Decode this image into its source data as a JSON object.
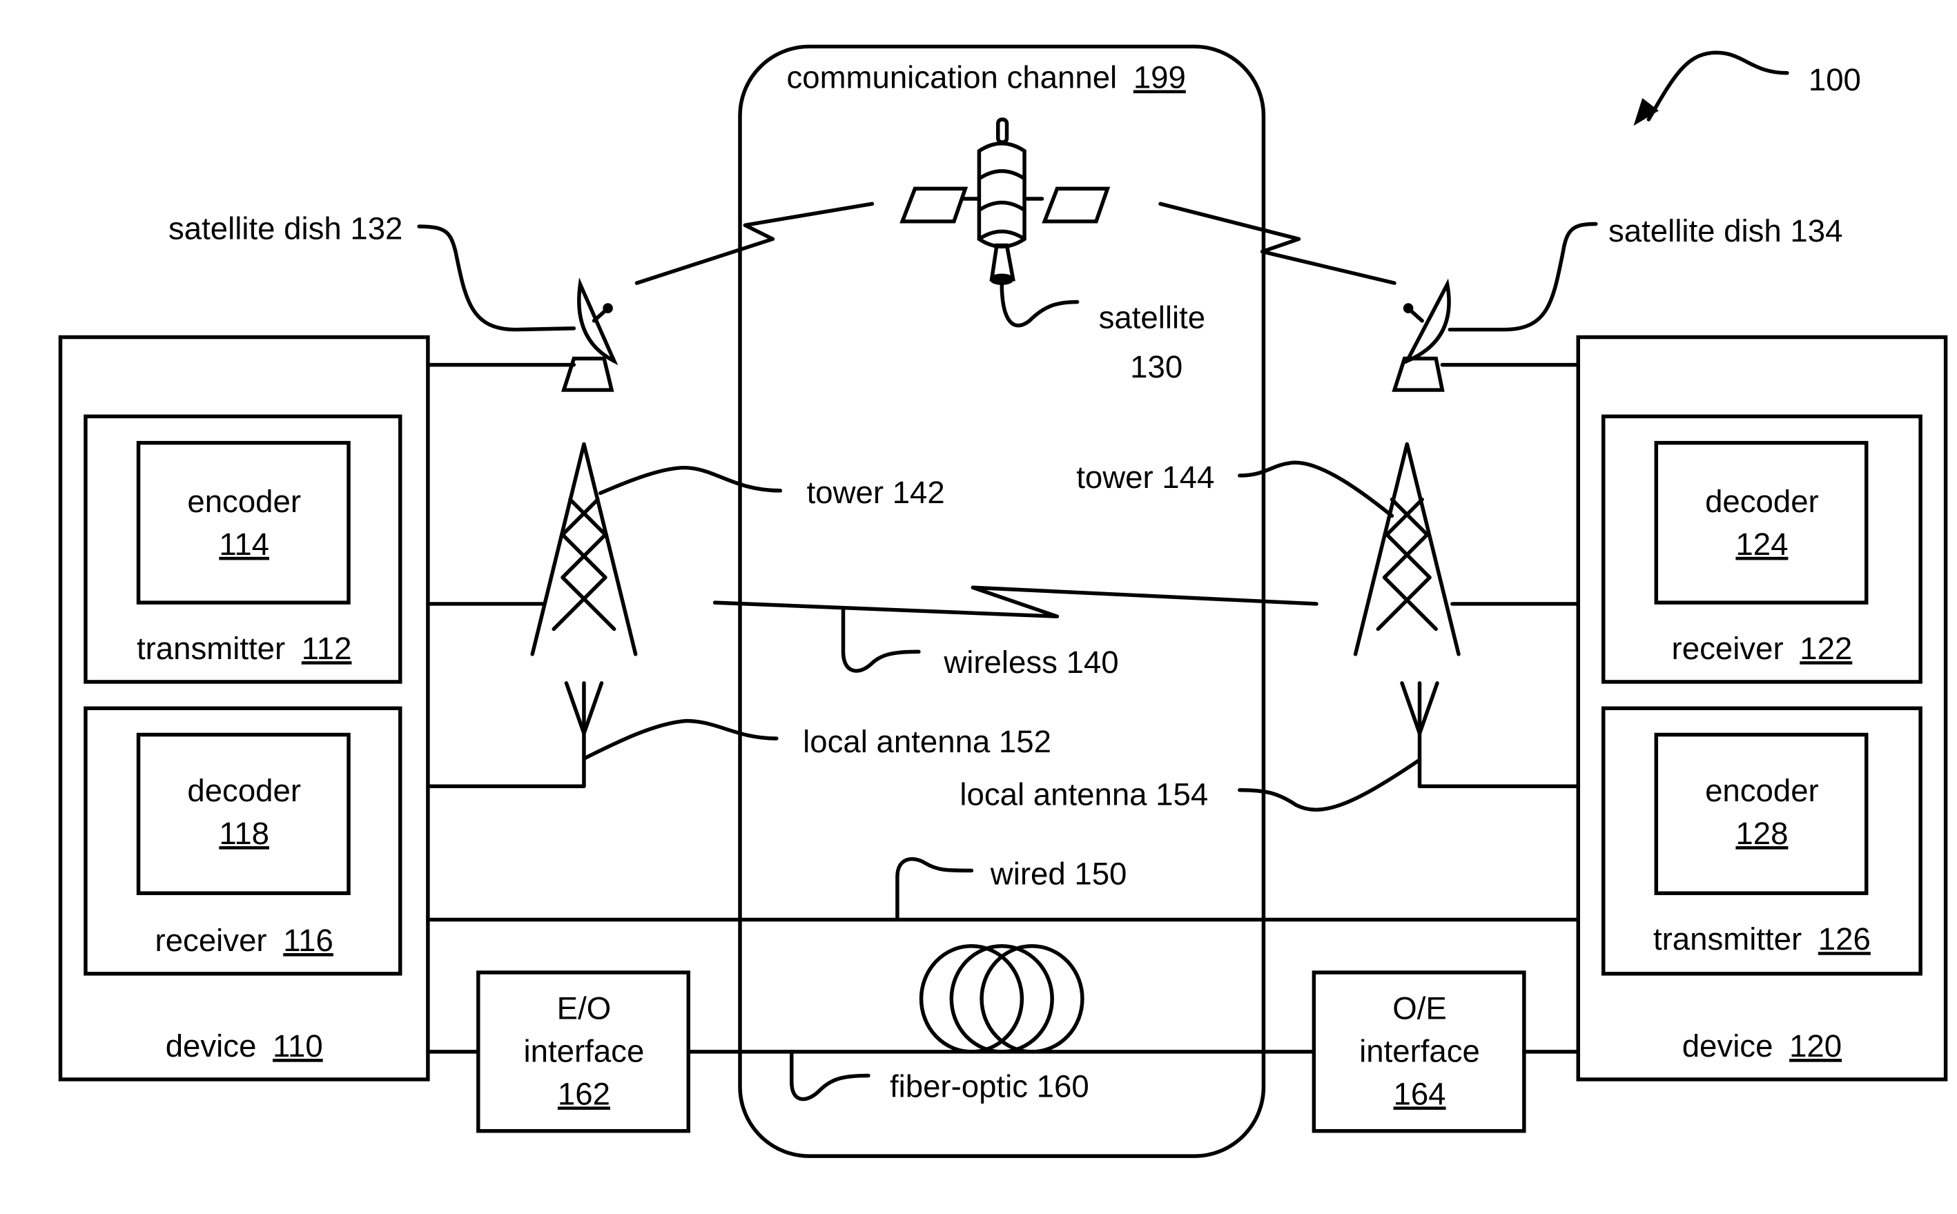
{
  "figure": {
    "ref": "100"
  },
  "channel": {
    "label": "communication channel",
    "ref": "199"
  },
  "satellite": {
    "label": "satellite",
    "ref": "130"
  },
  "satellite_dish_left": {
    "label": "satellite dish 132"
  },
  "satellite_dish_right": {
    "label": "satellite dish 134"
  },
  "tower_left": {
    "label": "tower 142"
  },
  "tower_right": {
    "label": "tower 144"
  },
  "wireless": {
    "label": "wireless 140"
  },
  "local_antenna_left": {
    "label": "local antenna 152"
  },
  "local_antenna_right": {
    "label": "local antenna 154"
  },
  "wired": {
    "label": "wired 150"
  },
  "fiber": {
    "label": "fiber-optic 160"
  },
  "device_left": {
    "label": "device",
    "ref": "110",
    "transmitter": {
      "label": "transmitter",
      "ref": "112",
      "encoder": {
        "label": "encoder",
        "ref": "114"
      }
    },
    "receiver": {
      "label": "receiver",
      "ref": "116",
      "decoder": {
        "label": "decoder",
        "ref": "118"
      }
    }
  },
  "device_right": {
    "label": "device",
    "ref": "120",
    "receiver": {
      "label": "receiver",
      "ref": "122",
      "decoder": {
        "label": "decoder",
        "ref": "124"
      }
    },
    "transmitter": {
      "label": "transmitter",
      "ref": "126",
      "encoder": {
        "label": "encoder",
        "ref": "128"
      }
    }
  },
  "eo_interface": {
    "line1": "E/O",
    "line2": "interface",
    "ref": "162"
  },
  "oe_interface": {
    "line1": "O/E",
    "line2": "interface",
    "ref": "164"
  }
}
